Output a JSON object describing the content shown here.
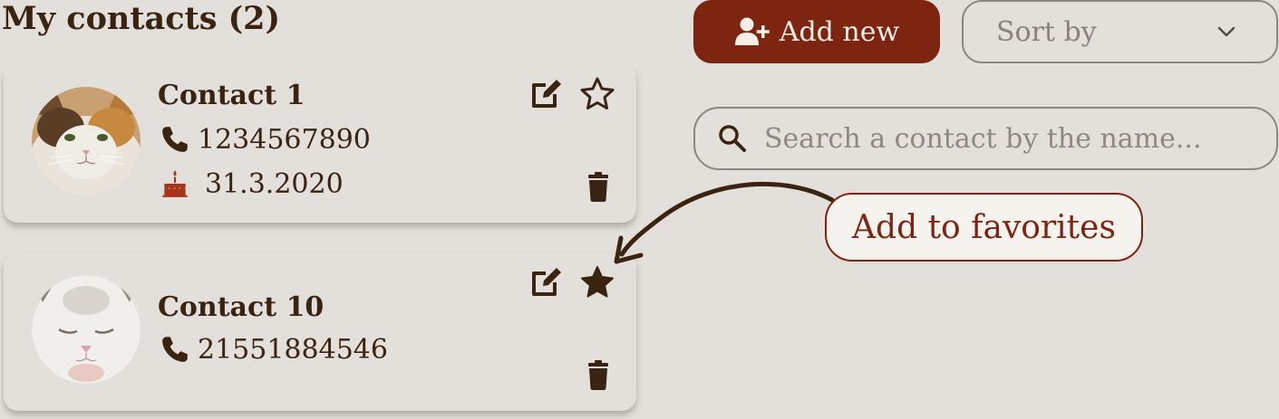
{
  "header": {
    "title": "My contacts (2)"
  },
  "toolbar": {
    "add_label": "Add new",
    "sort_label": "Sort by",
    "search_placeholder": "Search a contact by the name..."
  },
  "tooltip": {
    "text": "Add to favorites"
  },
  "contacts": [
    {
      "name": "Contact 1",
      "phone": "1234567890",
      "birthday": "31.3.2020",
      "favorite": false
    },
    {
      "name": "Contact 10",
      "phone": "21551884546",
      "favorite": true
    }
  ],
  "icons": {
    "add": "user-plus-icon",
    "sort": "chevron-down-icon",
    "search": "search-icon",
    "phone": "phone-icon",
    "birthday": "cake-icon",
    "edit": "edit-icon",
    "favorite": "star-icon",
    "delete": "trash-icon"
  },
  "colors": {
    "background": "#e3dfda",
    "accent": "#7d2510",
    "text": "#3a2310",
    "muted": "#8f8780",
    "cake": "#a8351a"
  }
}
